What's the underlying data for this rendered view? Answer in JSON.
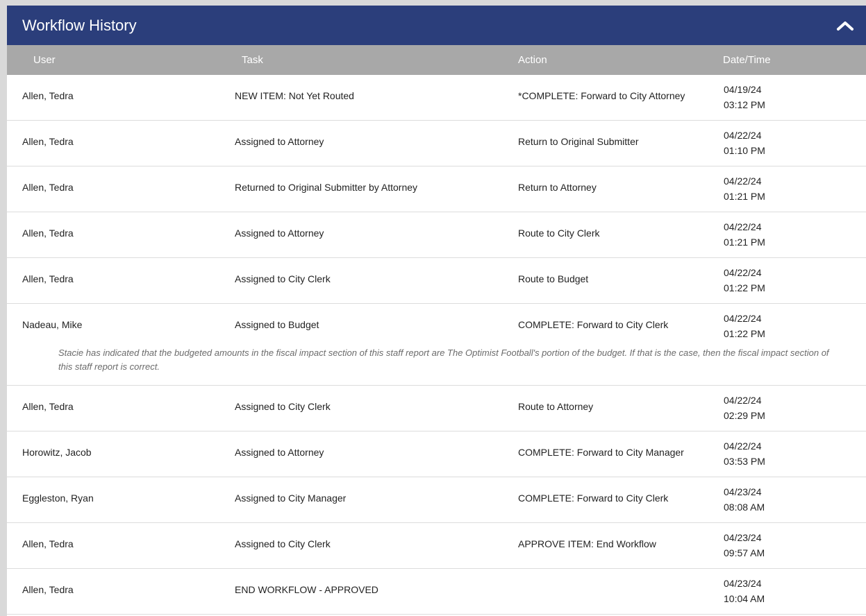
{
  "panel": {
    "title": "Workflow History",
    "collapse_icon": "chevron-up-icon",
    "header_color": "#2b3e7b",
    "column_header_color": "#a8a8a8"
  },
  "columns": {
    "user": "User",
    "task": "Task",
    "action": "Action",
    "datetime": "Date/Time"
  },
  "rows": [
    {
      "user": "Allen, Tedra",
      "task": "NEW ITEM: Not Yet Routed",
      "action": "*COMPLETE: Forward to City Attorney",
      "date": "04/19/24",
      "time": "03:12 PM",
      "comment": ""
    },
    {
      "user": "Allen, Tedra",
      "task": "Assigned to Attorney",
      "action": "Return to Original Submitter",
      "date": "04/22/24",
      "time": "01:10 PM",
      "comment": ""
    },
    {
      "user": "Allen, Tedra",
      "task": "Returned to Original Submitter by Attorney",
      "action": "Return to Attorney",
      "date": "04/22/24",
      "time": "01:21 PM",
      "comment": ""
    },
    {
      "user": "Allen, Tedra",
      "task": "Assigned to Attorney",
      "action": "Route to City Clerk",
      "date": "04/22/24",
      "time": "01:21 PM",
      "comment": ""
    },
    {
      "user": "Allen, Tedra",
      "task": "Assigned to City Clerk",
      "action": "Route to Budget",
      "date": "04/22/24",
      "time": "01:22 PM",
      "comment": ""
    },
    {
      "user": "Nadeau, Mike",
      "task": "Assigned to Budget",
      "action": "COMPLETE: Forward to City Clerk",
      "date": "04/22/24",
      "time": "01:22 PM",
      "comment": "Stacie has indicated that the budgeted amounts in the fiscal impact section of this staff report are The Optimist Football's portion of the budget. If that is the case, then the fiscal impact section of this staff report is correct."
    },
    {
      "user": "Allen, Tedra",
      "task": "Assigned to City Clerk",
      "action": "Route to Attorney",
      "date": "04/22/24",
      "time": "02:29 PM",
      "comment": ""
    },
    {
      "user": "Horowitz, Jacob",
      "task": "Assigned to Attorney",
      "action": "COMPLETE: Forward to City Manager",
      "date": "04/22/24",
      "time": "03:53 PM",
      "comment": ""
    },
    {
      "user": "Eggleston, Ryan",
      "task": "Assigned to City Manager",
      "action": "COMPLETE: Forward to City Clerk",
      "date": "04/23/24",
      "time": "08:08 AM",
      "comment": ""
    },
    {
      "user": "Allen, Tedra",
      "task": "Assigned to City Clerk",
      "action": "APPROVE ITEM: End Workflow",
      "date": "04/23/24",
      "time": "09:57 AM",
      "comment": ""
    },
    {
      "user": "Allen, Tedra",
      "task": "END WORKFLOW - APPROVED",
      "action": "",
      "date": "04/23/24",
      "time": "10:04 AM",
      "comment": ""
    }
  ]
}
